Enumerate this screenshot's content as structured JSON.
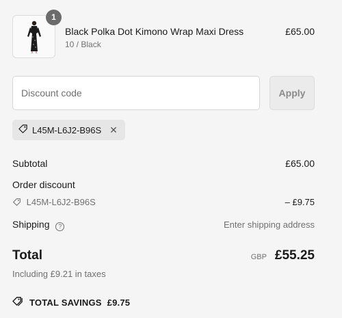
{
  "line_item": {
    "quantity": "1",
    "title": "Black Polka Dot Kimono Wrap Maxi Dress",
    "variant": "10 / Black",
    "price": "£65.00"
  },
  "discount": {
    "placeholder": "Discount code",
    "apply_label": "Apply",
    "applied_code": "L45M-L6J2-B96S"
  },
  "summary": {
    "subtotal_label": "Subtotal",
    "subtotal_value": "£65.00",
    "order_discount_label": "Order discount",
    "discount_code": "L45M-L6J2-B96S",
    "discount_value": "– £9.75",
    "shipping_label": "Shipping",
    "shipping_value": "Enter shipping address",
    "total_label": "Total",
    "currency": "GBP",
    "total_value": "£55.25",
    "taxes_note": "Including £9.21 in taxes",
    "savings_label": "TOTAL SAVINGS",
    "savings_value": "£9.75"
  },
  "icons": {
    "tag": "tag-icon",
    "close": "close-icon",
    "help": "question-circle-icon",
    "savings": "discount-tag-icon"
  }
}
